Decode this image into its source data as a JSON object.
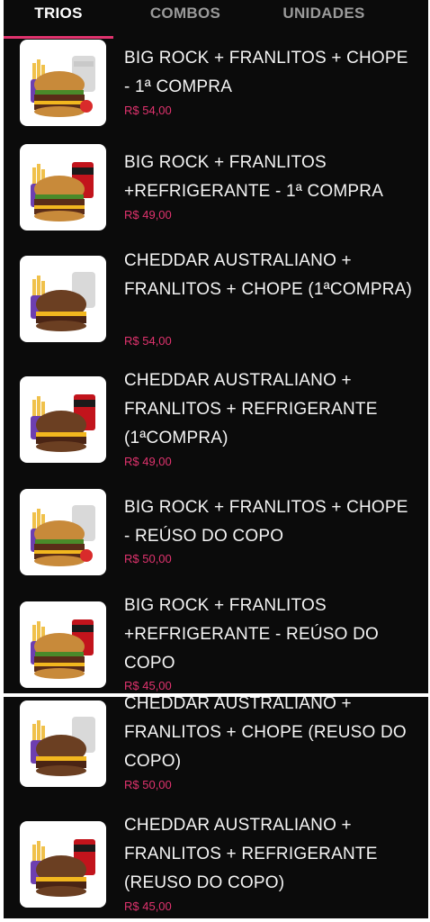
{
  "tabs": [
    {
      "label": "TRIOS",
      "active": true
    },
    {
      "label": "COMBOS",
      "active": false
    },
    {
      "label": "UNIDADES",
      "active": false
    }
  ],
  "colors": {
    "accent": "#e0336e",
    "background": "#0b0b0b",
    "text": "#f4f4f4",
    "tab_inactive": "#9a9a9a"
  },
  "products": [
    {
      "title": "BIG ROCK + FRANLITOS + CHOPE - 1ª COMPRA",
      "price": "R$ 54,00",
      "image": "burger-fries-beer-cup-image"
    },
    {
      "title": "BIG ROCK + FRANLITOS +REFRIGERANTE - 1ª COMPRA",
      "price": "R$ 49,00",
      "image": "burger-fries-soda-can-image"
    },
    {
      "title": "CHEDDAR AUSTRALIANO + FRANLITOS + CHOPE (1ªCOMPRA)",
      "price": "R$ 54,00",
      "image": "dark-bun-burger-fries-beer-cup-image"
    },
    {
      "title": "CHEDDAR AUSTRALIANO + FRANLITOS + REFRIGERANTE (1ªCOMPRA)",
      "price": "R$ 49,00",
      "image": "dark-bun-burger-fries-soda-can-image"
    },
    {
      "title": "BIG ROCK + FRANLITOS + CHOPE - REÚSO DO COPO",
      "price": "R$ 50,00",
      "image": "burger-fries-beer-cup-image"
    },
    {
      "title": "BIG ROCK + FRANLITOS +REFRIGERANTE - REÚSO DO COPO",
      "price": "R$ 45,00",
      "image": "burger-fries-soda-can-image"
    },
    {
      "title": "CHEDDAR AUSTRALIANO + FRANLITOS + CHOPE (REUSO DO COPO)",
      "price": "R$ 50,00",
      "image": "dark-bun-burger-fries-beer-cup-image"
    },
    {
      "title": "CHEDDAR AUSTRALIANO + FRANLITOS + REFRIGERANTE (REUSO DO COPO)",
      "price": "R$ 45,00",
      "image": "dark-bun-burger-fries-soda-can-image"
    }
  ]
}
